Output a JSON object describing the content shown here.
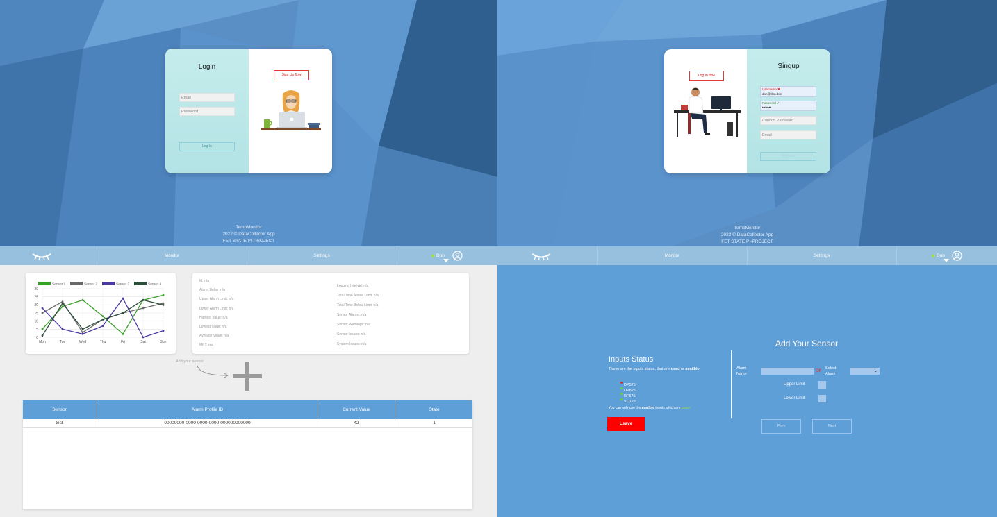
{
  "login": {
    "title": "Login",
    "email_placeholder": "Email",
    "password_placeholder": "Password",
    "login_button": "Log In",
    "signup_flow_button": "Sign Up flow"
  },
  "signup": {
    "title": "Singup",
    "log_in_flow_button": "Log In flow",
    "username_label": "Username ✖",
    "username_value": "don@don.don",
    "password_label": "Password ✔",
    "password_value": "••••••••",
    "confirm_password_placeholder": "Confirm Password",
    "email_placeholder": "Email",
    "register_button": "Register"
  },
  "footer": {
    "line1": "TempMonitor",
    "line2": "2022 © DataCollector App",
    "line3": "FET STATE PI-PROJECT"
  },
  "nav": {
    "monitor": "Monitor",
    "settings": "Settings",
    "user": "Don",
    "status_color": "#9be23a"
  },
  "chart_data": {
    "type": "line",
    "categories": [
      "Mon",
      "Tue",
      "Wed",
      "Thu",
      "Fri",
      "Sat",
      "Sun"
    ],
    "ylim": [
      0,
      30
    ],
    "yticks": [
      "0",
      "5",
      "10",
      "15",
      "20",
      "25",
      "30"
    ],
    "series": [
      {
        "name": "Sensor 1",
        "color": "#3a9e2a",
        "values": [
          5,
          19,
          23,
          13,
          2,
          23,
          26
        ]
      },
      {
        "name": "Sensor 2",
        "color": "#6a6a6a",
        "values": [
          15,
          22,
          3,
          11,
          15,
          18,
          21
        ]
      },
      {
        "name": "Sensor 3",
        "color": "#4a3aa0",
        "values": [
          18,
          5,
          2,
          7,
          24,
          0,
          4
        ]
      },
      {
        "name": "Sensor 4",
        "color": "#2e4d3b",
        "values": [
          1,
          21,
          5,
          11,
          15,
          23,
          20
        ]
      }
    ]
  },
  "monitor": {
    "info_left": [
      "Id: n/a",
      "Alarm Delay: n/a",
      "Upper Alarm Limit: n/a",
      "Lower Alarm Limit: n/a",
      "Highest Value: n/a",
      "Lowest Value: n/a",
      "Average Value: n/a",
      "MKT: n/a"
    ],
    "info_right": [
      "Logging Interval: n/a",
      "Total Time Above Limit: n/a",
      "Total Time Below Limit: n/a",
      "Sensor Alarms: n/a",
      "Sensor Warnings: n/a",
      "Sensor Issues: n/a",
      "System Issues: n/a"
    ],
    "add_sensor_hint": "Add your sensor",
    "table_headers": [
      "Sensor",
      "Alarm Profile ID",
      "Current Value",
      "State"
    ],
    "rows": [
      {
        "sensor": "test",
        "alarm_profile_id": "00000000-0000-0000-0000-000000000000",
        "current_value": "42",
        "state": "1"
      }
    ]
  },
  "add_sensor": {
    "title": "Add Your Sensor",
    "inputs_title": "Inputs Status",
    "desc_pre": "These are the inputs status, that are ",
    "desc_used": "used",
    "desc_mid": " or ",
    "desc_avail": "availble",
    "inputs": [
      {
        "name": "DP575",
        "color": "#e0302a"
      },
      {
        "name": "DP825",
        "color": "#62d23a"
      },
      {
        "name": "RF575",
        "color": "#62d23a"
      },
      {
        "name": "VC123",
        "color": "#62d23a"
      }
    ],
    "note_pre": "You can only use the ",
    "note_avail": "availble",
    "note_mid": " inputs which are ",
    "note_green": "green",
    "leave_button": "Leave",
    "alarm_name_label": "Alarm Name",
    "off_label": "Off",
    "select_alarm_label": "Select Alarm",
    "upper_limit_label": "Upper Limit",
    "lower_limit_label": "Lower Limit",
    "prev_button": "Prev",
    "next_button": "Next"
  }
}
